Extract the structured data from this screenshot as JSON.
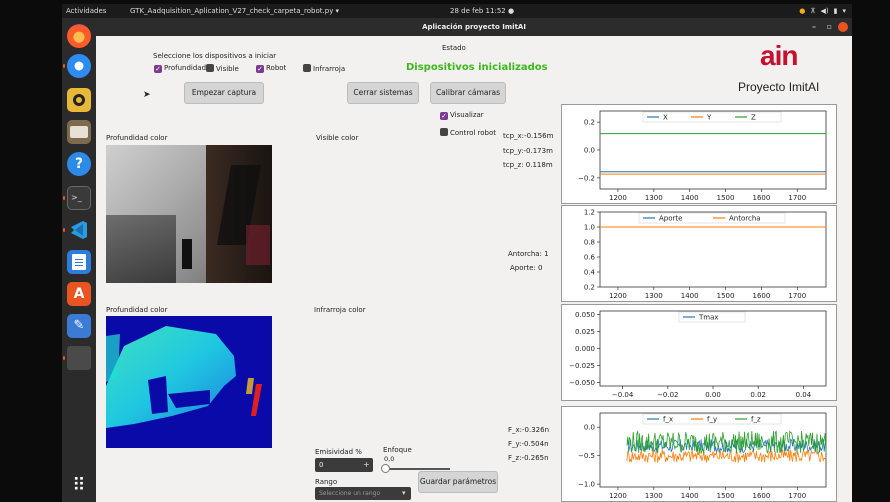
{
  "topbar": {
    "activities": "Actividades",
    "app_name": "GTK_Aadquisition_Aplication_V27_check_carpeta_robot.py ▾",
    "clock": "28 de feb  11:52 ●"
  },
  "window": {
    "title": "Aplicación proyecto ImitAI",
    "controls": {
      "minimize": "–",
      "maximize": "▫"
    }
  },
  "devices": {
    "prompt": "Seleccione los dispositivos a iniciar",
    "options": [
      {
        "label": "Profundidad",
        "checked": true
      },
      {
        "label": "Visible",
        "checked": false
      },
      {
        "label": "Robot",
        "checked": true
      },
      {
        "label": "Infrarroja",
        "checked": false
      }
    ]
  },
  "status": {
    "label": "Estado",
    "value": "Dispositivos inicializados",
    "color": "#3cb81c"
  },
  "brand": {
    "logo": "ain",
    "project": "Proyecto ImitAI",
    "color": "#c6102e"
  },
  "buttons": {
    "start_capture": "Empezar captura",
    "close_systems": "Cerrar sistemas",
    "calibrate": "Calibrar cámaras",
    "save_params": "Guardar parámetros"
  },
  "toggles": {
    "visualize": {
      "label": "Visualizar",
      "checked": true
    },
    "robot_control": {
      "label": "Control robot",
      "checked": false
    }
  },
  "panels": {
    "depth_color_top": "Profundidad color",
    "visible_color": "Visible color",
    "depth_color_bottom": "Profundidad color",
    "infrared_color": "Infrarroja color"
  },
  "readouts": {
    "tcp_x": "tcp_x:-0.156m",
    "tcp_y": "tcp_y:-0.173m",
    "tcp_z": "tcp_z: 0.118m",
    "antorcha": "Antorcha: 1",
    "aporte": "Aporte: 0",
    "f_x": "F_x:-0.326n",
    "f_y": "F_y:-0.504n",
    "f_z": "F_z:-0.265n"
  },
  "params": {
    "emissivity_label": "Emisividad %",
    "emissivity_value": "0",
    "focus_label": "Enfoque",
    "focus_value": "0,0",
    "range_label": "Rango",
    "range_placeholder": "Seleccione un rango"
  },
  "icons": {
    "dock": [
      "firefox-icon",
      "thunderbird-icon",
      "rhythmbox-icon",
      "files-icon",
      "help-icon",
      "terminal-icon",
      "vscode-icon",
      "writer-icon",
      "software-icon",
      "editor-icon",
      "app-grid-icon"
    ],
    "spinbutton_plus": "+",
    "dropdown_arrow": "▾",
    "app_grid": "⠿"
  },
  "chart_data": [
    {
      "type": "line",
      "series": [
        {
          "name": "X",
          "color": "#1f77b4",
          "values": [
            -0.156,
            -0.156
          ]
        },
        {
          "name": "Y",
          "color": "#ff7f0e",
          "values": [
            -0.173,
            -0.173
          ]
        },
        {
          "name": "Z",
          "color": "#2ca02c",
          "values": [
            0.118,
            0.118
          ]
        }
      ],
      "x": [
        1150,
        1780
      ],
      "xticks": [
        "1200",
        "1300",
        "1400",
        "1500",
        "1600",
        "1700"
      ],
      "yticks": [
        "0.2",
        "0.0",
        "−0.2"
      ],
      "ylim": [
        -0.28,
        0.28
      ],
      "legend": "top-center"
    },
    {
      "type": "line",
      "series": [
        {
          "name": "Aporte",
          "color": "#1f77b4",
          "values": [
            1.0,
            1.0
          ]
        },
        {
          "name": "Antorcha",
          "color": "#ff7f0e",
          "values": [
            1.0,
            1.0
          ]
        }
      ],
      "x": [
        1150,
        1780
      ],
      "xticks": [
        "1200",
        "1300",
        "1400",
        "1500",
        "1600",
        "1700"
      ],
      "yticks": [
        "1.2",
        "1.0",
        "0.8",
        "0.6",
        "0.4",
        "0.2"
      ],
      "ylim": [
        0.2,
        1.2
      ],
      "legend": "top-center"
    },
    {
      "type": "line",
      "series": [
        {
          "name": "Tmax",
          "color": "#1f77b4",
          "values": []
        }
      ],
      "xticks": [
        "−0.04",
        "−0.02",
        "0.00",
        "0.02",
        "0.04"
      ],
      "yticks": [
        "0.050",
        "0.025",
        "0.000",
        "−0.025",
        "−0.050"
      ],
      "xlim": [
        -0.05,
        0.05
      ],
      "ylim": [
        -0.055,
        0.055
      ],
      "legend": "top-center"
    },
    {
      "type": "line",
      "series": [
        {
          "name": "f_x",
          "color": "#1f77b4",
          "mean": -0.326,
          "noise": 0.12
        },
        {
          "name": "f_y",
          "color": "#ff7f0e",
          "mean": -0.504,
          "noise": 0.12
        },
        {
          "name": "f_z",
          "color": "#2ca02c",
          "mean": -0.265,
          "noise": 0.2
        }
      ],
      "x": [
        1150,
        1780
      ],
      "xticks": [
        "1200",
        "1300",
        "1400",
        "1500",
        "1600",
        "1700"
      ],
      "yticks": [
        "0.0",
        "−0.5",
        "−1.0"
      ],
      "ylim": [
        -1.05,
        0.25
      ],
      "legend": "top-center"
    }
  ]
}
